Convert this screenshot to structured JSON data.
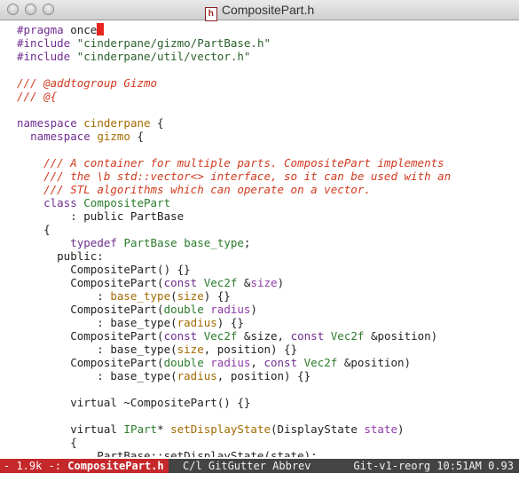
{
  "window": {
    "title": "CompositePart.h",
    "file_icon": "h"
  },
  "code": [
    {
      "segs": [
        [
          "k",
          "#pragma"
        ],
        [
          "n",
          " once"
        ]
      ],
      "cursor": true
    },
    {
      "segs": [
        [
          "k",
          "#include"
        ],
        [
          "n",
          " "
        ],
        [
          "s",
          "\"cinderpane/gizmo/PartBase.h\""
        ]
      ]
    },
    {
      "segs": [
        [
          "k",
          "#include"
        ],
        [
          "n",
          " "
        ],
        [
          "s",
          "\"cinderpane/util/vector.h\""
        ]
      ]
    },
    {
      "segs": []
    },
    {
      "segs": [
        [
          "c",
          "/// @addtogroup Gizmo"
        ]
      ]
    },
    {
      "segs": [
        [
          "c",
          "/// @{"
        ]
      ]
    },
    {
      "segs": []
    },
    {
      "segs": [
        [
          "k",
          "namespace"
        ],
        [
          "n",
          " "
        ],
        [
          "f",
          "cinderpane"
        ],
        [
          "n",
          " {"
        ]
      ]
    },
    {
      "segs": [
        [
          "n",
          "  "
        ],
        [
          "k",
          "namespace"
        ],
        [
          "n",
          " "
        ],
        [
          "f",
          "gizmo"
        ],
        [
          "n",
          " {"
        ]
      ]
    },
    {
      "segs": []
    },
    {
      "segs": [
        [
          "n",
          "    "
        ],
        [
          "c",
          "/// A container for multiple parts. CompositePart implements"
        ]
      ]
    },
    {
      "segs": [
        [
          "n",
          "    "
        ],
        [
          "c",
          "/// the \\b std::vector<> interface, so it can be used with an"
        ]
      ]
    },
    {
      "segs": [
        [
          "n",
          "    "
        ],
        [
          "c",
          "/// STL algorithms which can operate on a vector."
        ]
      ]
    },
    {
      "segs": [
        [
          "n",
          "    "
        ],
        [
          "k",
          "class"
        ],
        [
          "n",
          " "
        ],
        [
          "t",
          "CompositePart"
        ]
      ]
    },
    {
      "segs": [
        [
          "n",
          "        : public PartBase"
        ]
      ]
    },
    {
      "segs": [
        [
          "n",
          "    {"
        ]
      ]
    },
    {
      "segs": [
        [
          "n",
          "        "
        ],
        [
          "k",
          "typedef"
        ],
        [
          "n",
          " "
        ],
        [
          "t",
          "PartBase"
        ],
        [
          "n",
          " "
        ],
        [
          "t",
          "base_type"
        ],
        [
          "n",
          ";"
        ]
      ]
    },
    {
      "segs": [
        [
          "n",
          "      public:"
        ]
      ]
    },
    {
      "segs": [
        [
          "n",
          "        CompositePart() {}"
        ]
      ]
    },
    {
      "segs": [
        [
          "n",
          "        CompositePart("
        ],
        [
          "k",
          "const"
        ],
        [
          "n",
          " "
        ],
        [
          "t",
          "Vec2f"
        ],
        [
          "n",
          " &"
        ],
        [
          "v",
          "size"
        ],
        [
          "n",
          ")"
        ]
      ]
    },
    {
      "segs": [
        [
          "n",
          "            : "
        ],
        [
          "f",
          "base_type"
        ],
        [
          "n",
          "("
        ],
        [
          "f",
          "size"
        ],
        [
          "n",
          ") {}"
        ]
      ]
    },
    {
      "segs": [
        [
          "n",
          "        CompositePart("
        ],
        [
          "t",
          "double"
        ],
        [
          "n",
          " "
        ],
        [
          "v",
          "radius"
        ],
        [
          "n",
          ")"
        ]
      ]
    },
    {
      "segs": [
        [
          "n",
          "            : base_type("
        ],
        [
          "f",
          "radius"
        ],
        [
          "n",
          ") {}"
        ]
      ]
    },
    {
      "segs": [
        [
          "n",
          "        CompositePart("
        ],
        [
          "k",
          "const"
        ],
        [
          "n",
          " "
        ],
        [
          "t",
          "Vec2f"
        ],
        [
          "n",
          " &size, "
        ],
        [
          "k",
          "const"
        ],
        [
          "n",
          " "
        ],
        [
          "t",
          "Vec2f"
        ],
        [
          "n",
          " &position)"
        ]
      ]
    },
    {
      "segs": [
        [
          "n",
          "            : base_type("
        ],
        [
          "f",
          "size"
        ],
        [
          "n",
          ", position) {}"
        ]
      ]
    },
    {
      "segs": [
        [
          "n",
          "        CompositePart("
        ],
        [
          "t",
          "double"
        ],
        [
          "n",
          " "
        ],
        [
          "v",
          "radius"
        ],
        [
          "n",
          ", "
        ],
        [
          "k",
          "const"
        ],
        [
          "n",
          " "
        ],
        [
          "t",
          "Vec2f"
        ],
        [
          "n",
          " &position)"
        ]
      ]
    },
    {
      "segs": [
        [
          "n",
          "            : base_type("
        ],
        [
          "f",
          "radius"
        ],
        [
          "n",
          ", position) {}"
        ]
      ]
    },
    {
      "segs": []
    },
    {
      "segs": [
        [
          "n",
          "        virtual ~CompositePart() {}"
        ]
      ]
    },
    {
      "segs": []
    },
    {
      "segs": [
        [
          "n",
          "        virtual "
        ],
        [
          "t",
          "IPart"
        ],
        [
          "n",
          "* "
        ],
        [
          "f",
          "setDisplayState"
        ],
        [
          "n",
          "(DisplayState "
        ],
        [
          "v",
          "state"
        ],
        [
          "n",
          ")"
        ]
      ]
    },
    {
      "segs": [
        [
          "n",
          "        {"
        ]
      ]
    },
    {
      "segs": [
        [
          "n",
          "            PartBase::setDisplayState(state);"
        ]
      ]
    }
  ],
  "modeline": {
    "status": "- 1.9k -: ",
    "buffer_name": "CompositePart.h",
    "modes": "C/l GitGutter Abbrev",
    "vc_time": "Git-v1-reorg 10:51AM 0.93"
  },
  "colors": {
    "keyword": "#6f2d8f",
    "string": "#2a5f2a",
    "comment": "#d03a1d",
    "type": "#2b7b2b",
    "function": "#a36b00",
    "variable": "#8e3aa7",
    "cursor": "#e8241f",
    "modeline_bg": "#444444",
    "modeline_buffer_bg": "#c5282b"
  }
}
